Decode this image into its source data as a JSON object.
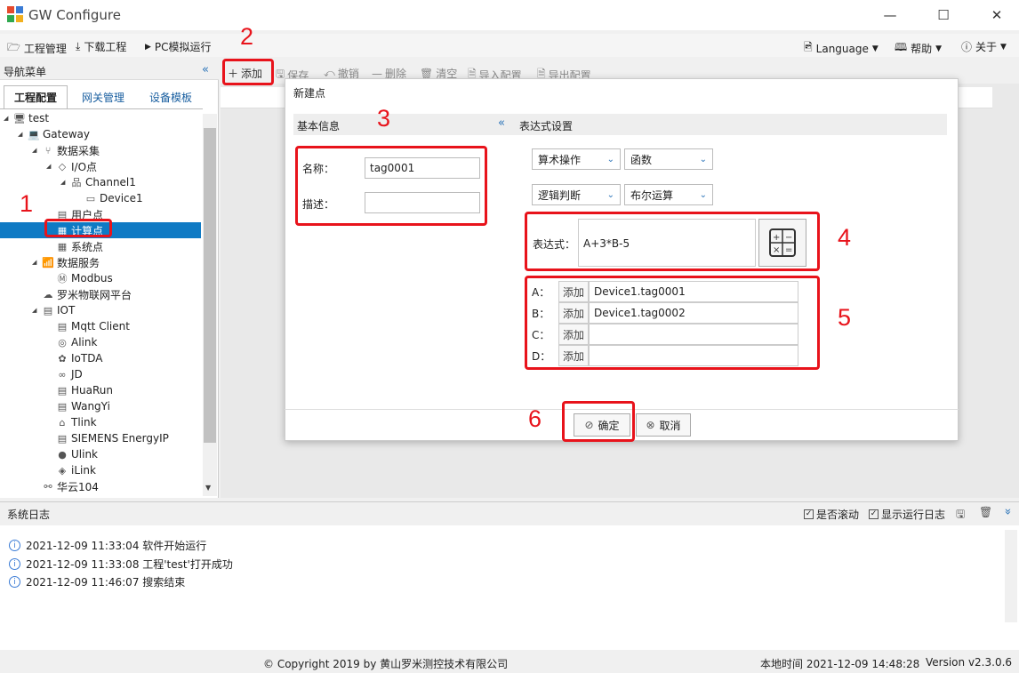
{
  "window": {
    "title": "GW Configure"
  },
  "menu": {
    "left": [
      {
        "label": "工程管理",
        "icon": "folder-icon"
      },
      {
        "label": "下载工程",
        "icon": "download-icon"
      },
      {
        "label": "PC模拟运行",
        "icon": "play-icon"
      }
    ],
    "right": [
      {
        "label": "Language",
        "icon": "language-icon"
      },
      {
        "label": "帮助",
        "icon": "book-icon"
      },
      {
        "label": "关于",
        "icon": "help-icon"
      }
    ]
  },
  "nav": {
    "header": "导航菜单",
    "tabs": [
      "工程配置",
      "网关管理",
      "设备模板"
    ],
    "tree": [
      {
        "label": "test",
        "level": 0,
        "arrow": "◢",
        "icon": "🖥"
      },
      {
        "label": "Gateway",
        "level": 1,
        "arrow": "◢",
        "icon": "💻"
      },
      {
        "label": "数据采集",
        "level": 2,
        "arrow": "◢",
        "icon": "⑂"
      },
      {
        "label": "I/O点",
        "level": 3,
        "arrow": "◢",
        "icon": "◇"
      },
      {
        "label": "Channel1",
        "level": 4,
        "arrow": "◢",
        "icon": "品"
      },
      {
        "label": "Device1",
        "level": 5,
        "arrow": "",
        "icon": "▭"
      },
      {
        "label": "用户点",
        "level": 3,
        "arrow": "",
        "icon": "▤"
      },
      {
        "label": "计算点",
        "level": 3,
        "arrow": "",
        "icon": "▦",
        "selected": true
      },
      {
        "label": "系统点",
        "level": 3,
        "arrow": "",
        "icon": "▦"
      },
      {
        "label": "数据服务",
        "level": 2,
        "arrow": "◢",
        "icon": "📶"
      },
      {
        "label": "Modbus",
        "level": 3,
        "arrow": "",
        "icon": "Ⓜ"
      },
      {
        "label": "罗米物联网平台",
        "level": 2,
        "arrow": "",
        "icon": "☁"
      },
      {
        "label": "IOT",
        "level": 2,
        "arrow": "◢",
        "icon": "▤"
      },
      {
        "label": "Mqtt Client",
        "level": 3,
        "arrow": "",
        "icon": "▤"
      },
      {
        "label": "Alink",
        "level": 3,
        "arrow": "",
        "icon": "◎"
      },
      {
        "label": "IoTDA",
        "level": 3,
        "arrow": "",
        "icon": "✿"
      },
      {
        "label": "JD",
        "level": 3,
        "arrow": "",
        "icon": "∞"
      },
      {
        "label": "HuaRun",
        "level": 3,
        "arrow": "",
        "icon": "▤"
      },
      {
        "label": "WangYi",
        "level": 3,
        "arrow": "",
        "icon": "▤"
      },
      {
        "label": "Tlink",
        "level": 3,
        "arrow": "",
        "icon": "⌂"
      },
      {
        "label": "SIEMENS EnergyIP",
        "level": 3,
        "arrow": "",
        "icon": "▤"
      },
      {
        "label": "Ulink",
        "level": 3,
        "arrow": "",
        "icon": "●"
      },
      {
        "label": "iLink",
        "level": 3,
        "arrow": "",
        "icon": "◈"
      },
      {
        "label": "华云104",
        "level": 2,
        "arrow": "",
        "icon": "⚯"
      }
    ]
  },
  "toolbar": {
    "items": [
      "添加",
      "保存",
      "撤销",
      "删除",
      "清空",
      "导入配置",
      "导出配置"
    ]
  },
  "dialog": {
    "title": "新建点",
    "basic_section": "基本信息",
    "expr_section": "表达式设置",
    "name_label": "名称：",
    "name_value": "tag0001",
    "desc_label": "描述：",
    "desc_value": "",
    "selects": [
      "算术操作",
      "函数",
      "逻辑判断",
      "布尔运算"
    ],
    "expr_label": "表达式：",
    "expr_value": "A+3*B-5",
    "vars": [
      {
        "label": "A：",
        "add": "添加",
        "value": "Device1.tag0001"
      },
      {
        "label": "B：",
        "add": "添加",
        "value": "Device1.tag0002"
      },
      {
        "label": "C：",
        "add": "添加",
        "value": ""
      },
      {
        "label": "D：",
        "add": "添加",
        "value": ""
      }
    ],
    "ok_label": "确定",
    "cancel_label": "取消"
  },
  "annotations": [
    "1",
    "2",
    "3",
    "4",
    "5",
    "6"
  ],
  "log": {
    "title": "系统日志",
    "auto_scroll": "是否滚动",
    "show_run_log": "显示运行日志",
    "entries": [
      "2021-12-09 11:33:04 软件开始运行",
      "2021-12-09 11:33:08 工程'test'打开成功",
      "2021-12-09 11:46:07 搜索结束"
    ]
  },
  "status": {
    "copyright": "© Copyright 2019 by 黄山罗米测控技术有限公司",
    "time_label": "本地时间 2021-12-09 14:48:28",
    "version": "Version v2.3.0.6"
  },
  "colors": {
    "accent": "#0f7ac4",
    "annotation": "#e8131b"
  }
}
